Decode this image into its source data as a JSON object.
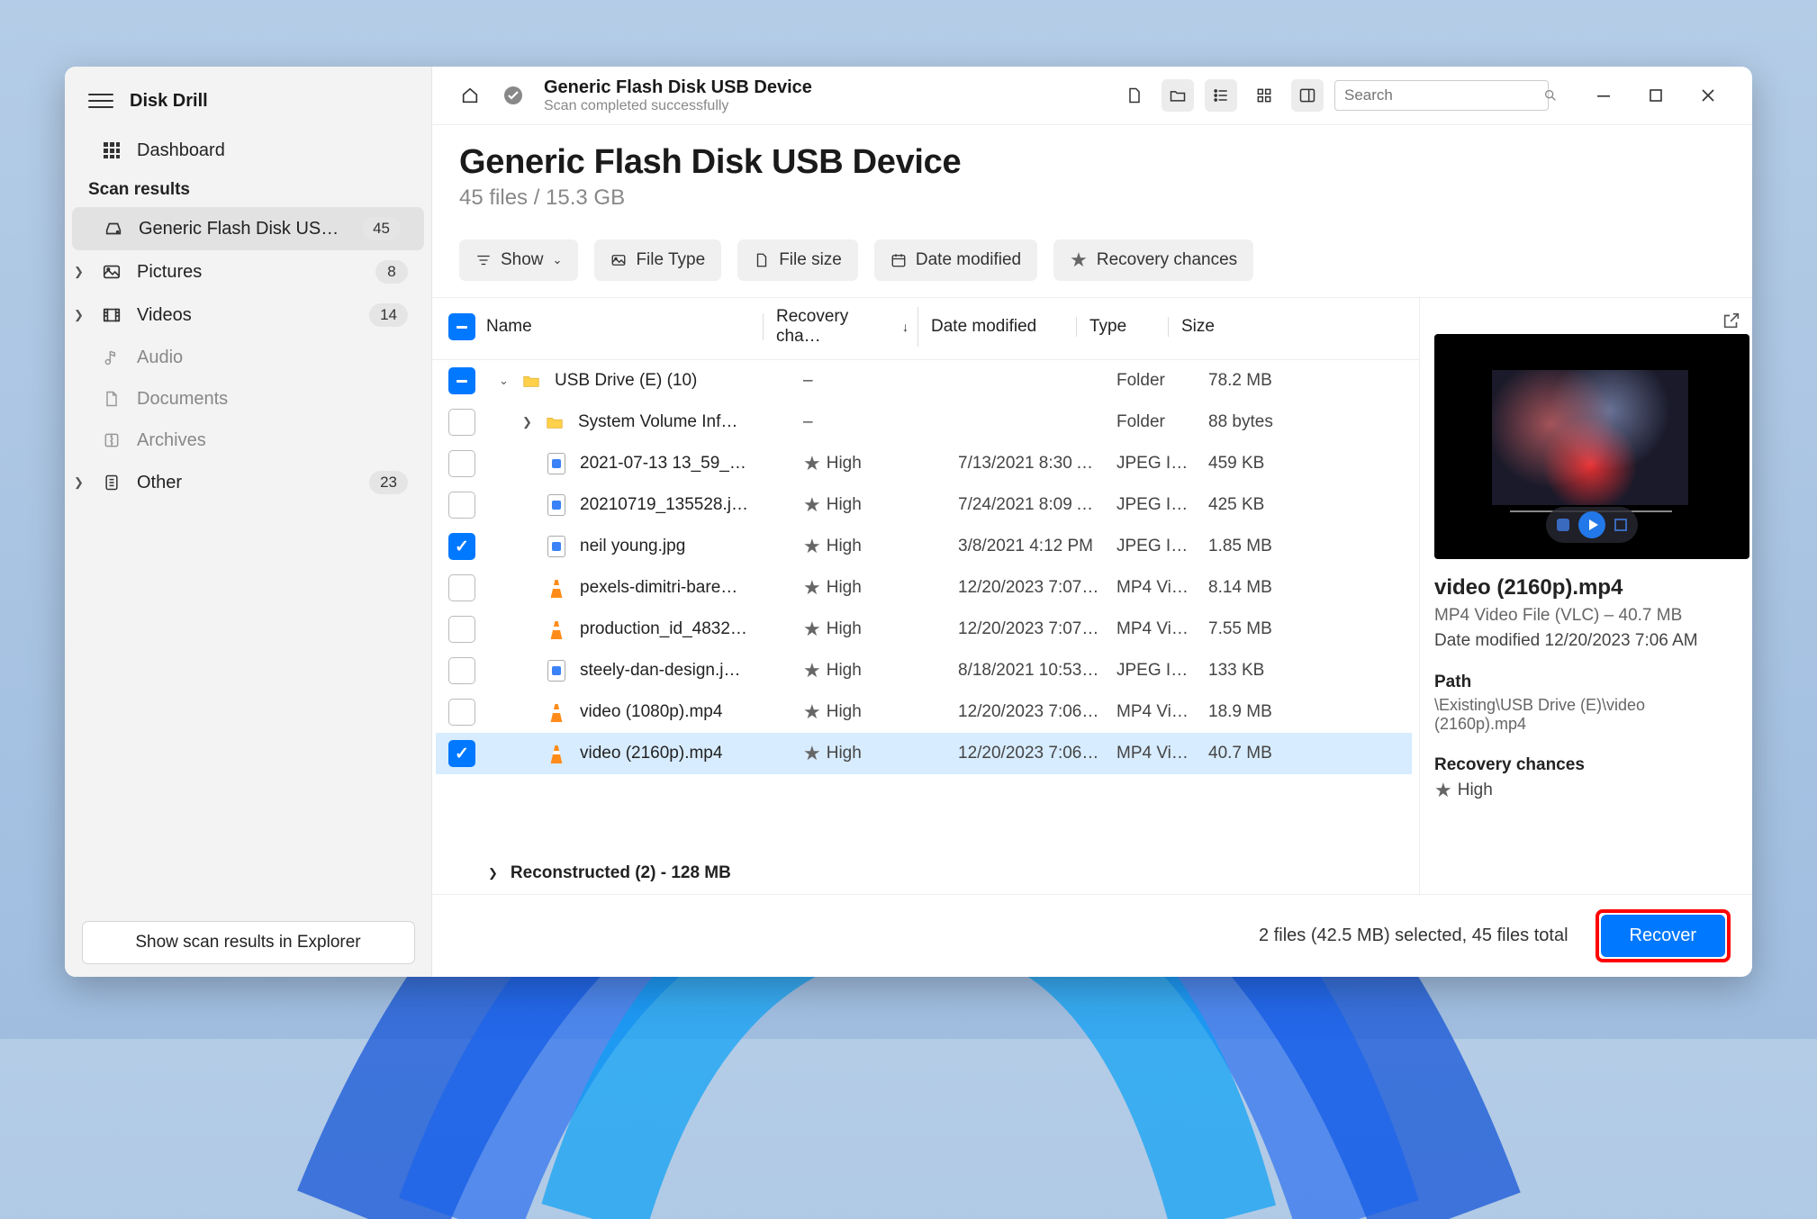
{
  "app": {
    "title": "Disk Drill"
  },
  "sidebar": {
    "dashboard": "Dashboard",
    "section_label": "Scan results",
    "items": [
      {
        "label": "Generic Flash Disk USB D…",
        "count": "45",
        "icon": "drive"
      },
      {
        "label": "Pictures",
        "count": "8",
        "icon": "image"
      },
      {
        "label": "Videos",
        "count": "14",
        "icon": "video"
      },
      {
        "label": "Audio",
        "count": "",
        "icon": "audio"
      },
      {
        "label": "Documents",
        "count": "",
        "icon": "document"
      },
      {
        "label": "Archives",
        "count": "",
        "icon": "archive"
      },
      {
        "label": "Other",
        "count": "23",
        "icon": "other"
      }
    ],
    "footer_button": "Show scan results in Explorer"
  },
  "toolbar": {
    "breadcrumb_title": "Generic Flash Disk USB Device",
    "breadcrumb_sub": "Scan completed successfully",
    "search_placeholder": "Search"
  },
  "header": {
    "title": "Generic Flash Disk USB Device",
    "subtitle": "45 files / 15.3 GB"
  },
  "filters": {
    "show": "Show",
    "file_type": "File Type",
    "file_size": "File size",
    "date_modified": "Date modified",
    "recovery_chances": "Recovery chances"
  },
  "columns": {
    "name": "Name",
    "recovery": "Recovery cha…",
    "date": "Date modified",
    "type": "Type",
    "size": "Size"
  },
  "rows": [
    {
      "indent": 1,
      "chk": "indeterminate",
      "expand": "down",
      "icon": "folder",
      "name": "USB Drive (E) (10)",
      "rec": "–",
      "date": "",
      "type": "Folder",
      "size": "78.2 MB"
    },
    {
      "indent": 2,
      "chk": "",
      "expand": "right",
      "icon": "folder",
      "name": "System Volume Inf…",
      "rec": "–",
      "date": "",
      "type": "Folder",
      "size": "88 bytes"
    },
    {
      "indent": 2,
      "chk": "",
      "icon": "jpeg",
      "name": "2021-07-13 13_59_…",
      "rec": "High",
      "date": "7/13/2021 8:30 A…",
      "type": "JPEG Im…",
      "size": "459 KB"
    },
    {
      "indent": 2,
      "chk": "",
      "icon": "jpeg",
      "name": "20210719_135528.j…",
      "rec": "High",
      "date": "7/24/2021 8:09 A…",
      "type": "JPEG Im…",
      "size": "425 KB"
    },
    {
      "indent": 2,
      "chk": "checked",
      "icon": "jpeg",
      "name": "neil young.jpg",
      "rec": "High",
      "date": "3/8/2021 4:12 PM",
      "type": "JPEG Im…",
      "size": "1.85 MB"
    },
    {
      "indent": 2,
      "chk": "",
      "icon": "vlc",
      "name": "pexels-dimitri-bare…",
      "rec": "High",
      "date": "12/20/2023 7:07…",
      "type": "MP4 Vi…",
      "size": "8.14 MB"
    },
    {
      "indent": 2,
      "chk": "",
      "icon": "vlc",
      "name": "production_id_4832…",
      "rec": "High",
      "date": "12/20/2023 7:07…",
      "type": "MP4 Vi…",
      "size": "7.55 MB"
    },
    {
      "indent": 2,
      "chk": "",
      "icon": "jpeg",
      "name": "steely-dan-design.j…",
      "rec": "High",
      "date": "8/18/2021 10:53…",
      "type": "JPEG Im…",
      "size": "133 KB"
    },
    {
      "indent": 2,
      "chk": "",
      "icon": "vlc",
      "name": "video (1080p).mp4",
      "rec": "High",
      "date": "12/20/2023 7:06…",
      "type": "MP4 Vi…",
      "size": "18.9 MB"
    },
    {
      "indent": 2,
      "chk": "checked",
      "selected": true,
      "icon": "vlc",
      "name": "video (2160p).mp4",
      "rec": "High",
      "date": "12/20/2023 7:06…",
      "type": "MP4 Vi…",
      "size": "40.7 MB"
    }
  ],
  "reconstructed": "Reconstructed (2) - 128 MB",
  "preview": {
    "name": "video (2160p).mp4",
    "type_line": "MP4 Video File (VLC) – 40.7 MB",
    "date_line": "Date modified 12/20/2023 7:06 AM",
    "path_label": "Path",
    "path_value": "\\Existing\\USB Drive (E)\\video (2160p).mp4",
    "rec_label": "Recovery chances",
    "rec_value": "High"
  },
  "footer": {
    "status": "2 files (42.5 MB) selected, 45 files total",
    "recover": "Recover"
  }
}
